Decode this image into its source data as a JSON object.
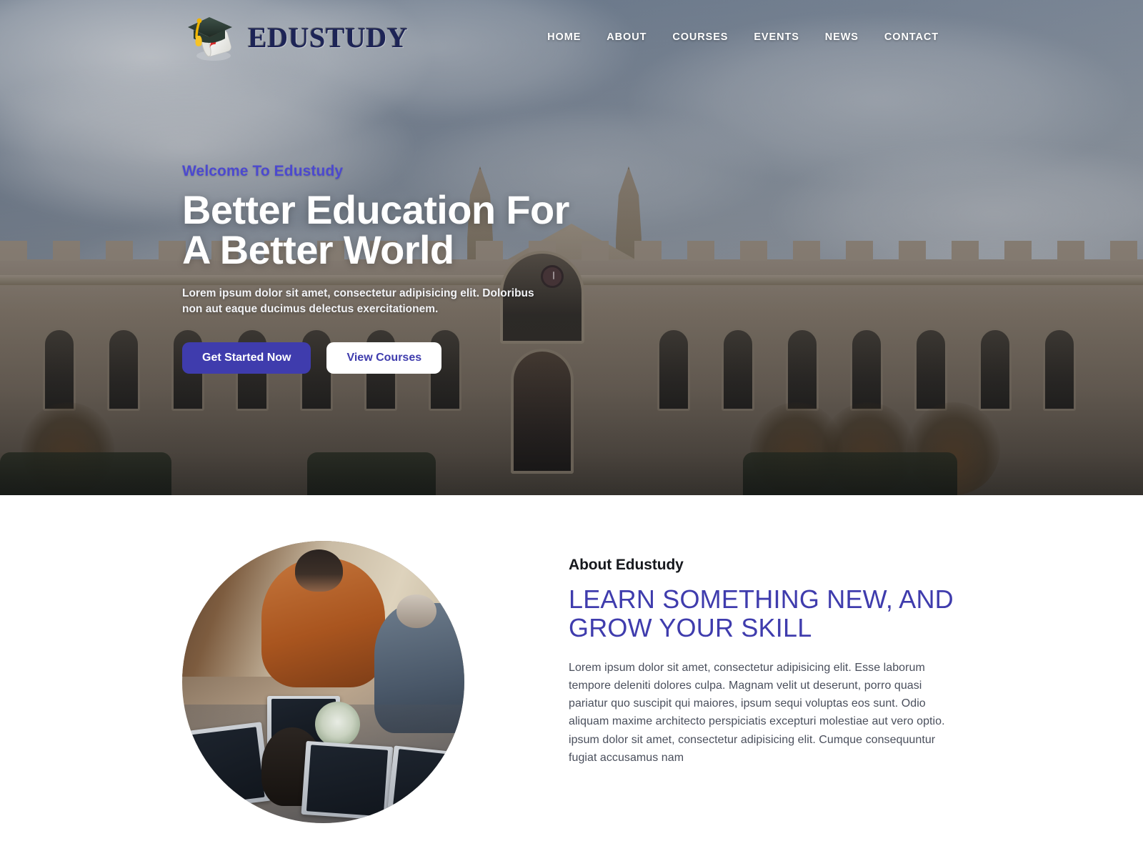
{
  "header": {
    "brand_name": "EDUSTUDY",
    "brand_logo_icon": "graduation-cap-diploma-icon",
    "nav": [
      {
        "label": "HOME"
      },
      {
        "label": "ABOUT"
      },
      {
        "label": "COURSES"
      },
      {
        "label": "EVENTS"
      },
      {
        "label": "NEWS"
      },
      {
        "label": "CONTACT"
      }
    ]
  },
  "hero": {
    "eyebrow": "Welcome To Edustudy",
    "title": "Better Education For A Better World",
    "description": "Lorem ipsum dolor sit amet, consectetur adipisicing elit. Doloribus non aut eaque ducimus delectus exercitationem.",
    "primary_button": "Get Started Now",
    "secondary_button": "View Courses",
    "background_image": "gothic-university-building-photo"
  },
  "about": {
    "image": "students-with-laptops-circular-photo",
    "kicker": "About Edustudy",
    "heading": "LEARN SOMETHING NEW, AND GROW YOUR SKILL",
    "text": "Lorem ipsum dolor sit amet, consectetur adipisicing elit. Esse laborum tempore deleniti dolores culpa. Magnam velit ut deserunt, porro quasi pariatur quo suscipit qui maiores, ipsum sequi voluptas eos sunt. Odio aliquam maxime architecto perspiciatis excepturi molestiae aut vero optio. ipsum dolor sit amet, consectetur adipisicing elit. Cumque consequuntur fugiat accusamus nam"
  },
  "colors": {
    "accent_indigo": "#3f3cad",
    "eyebrow_violet": "#4c49cf",
    "hero_text_white": "#ffffff",
    "body_text_gray": "#4a4f5c",
    "brand_navy": "#1d2456"
  }
}
